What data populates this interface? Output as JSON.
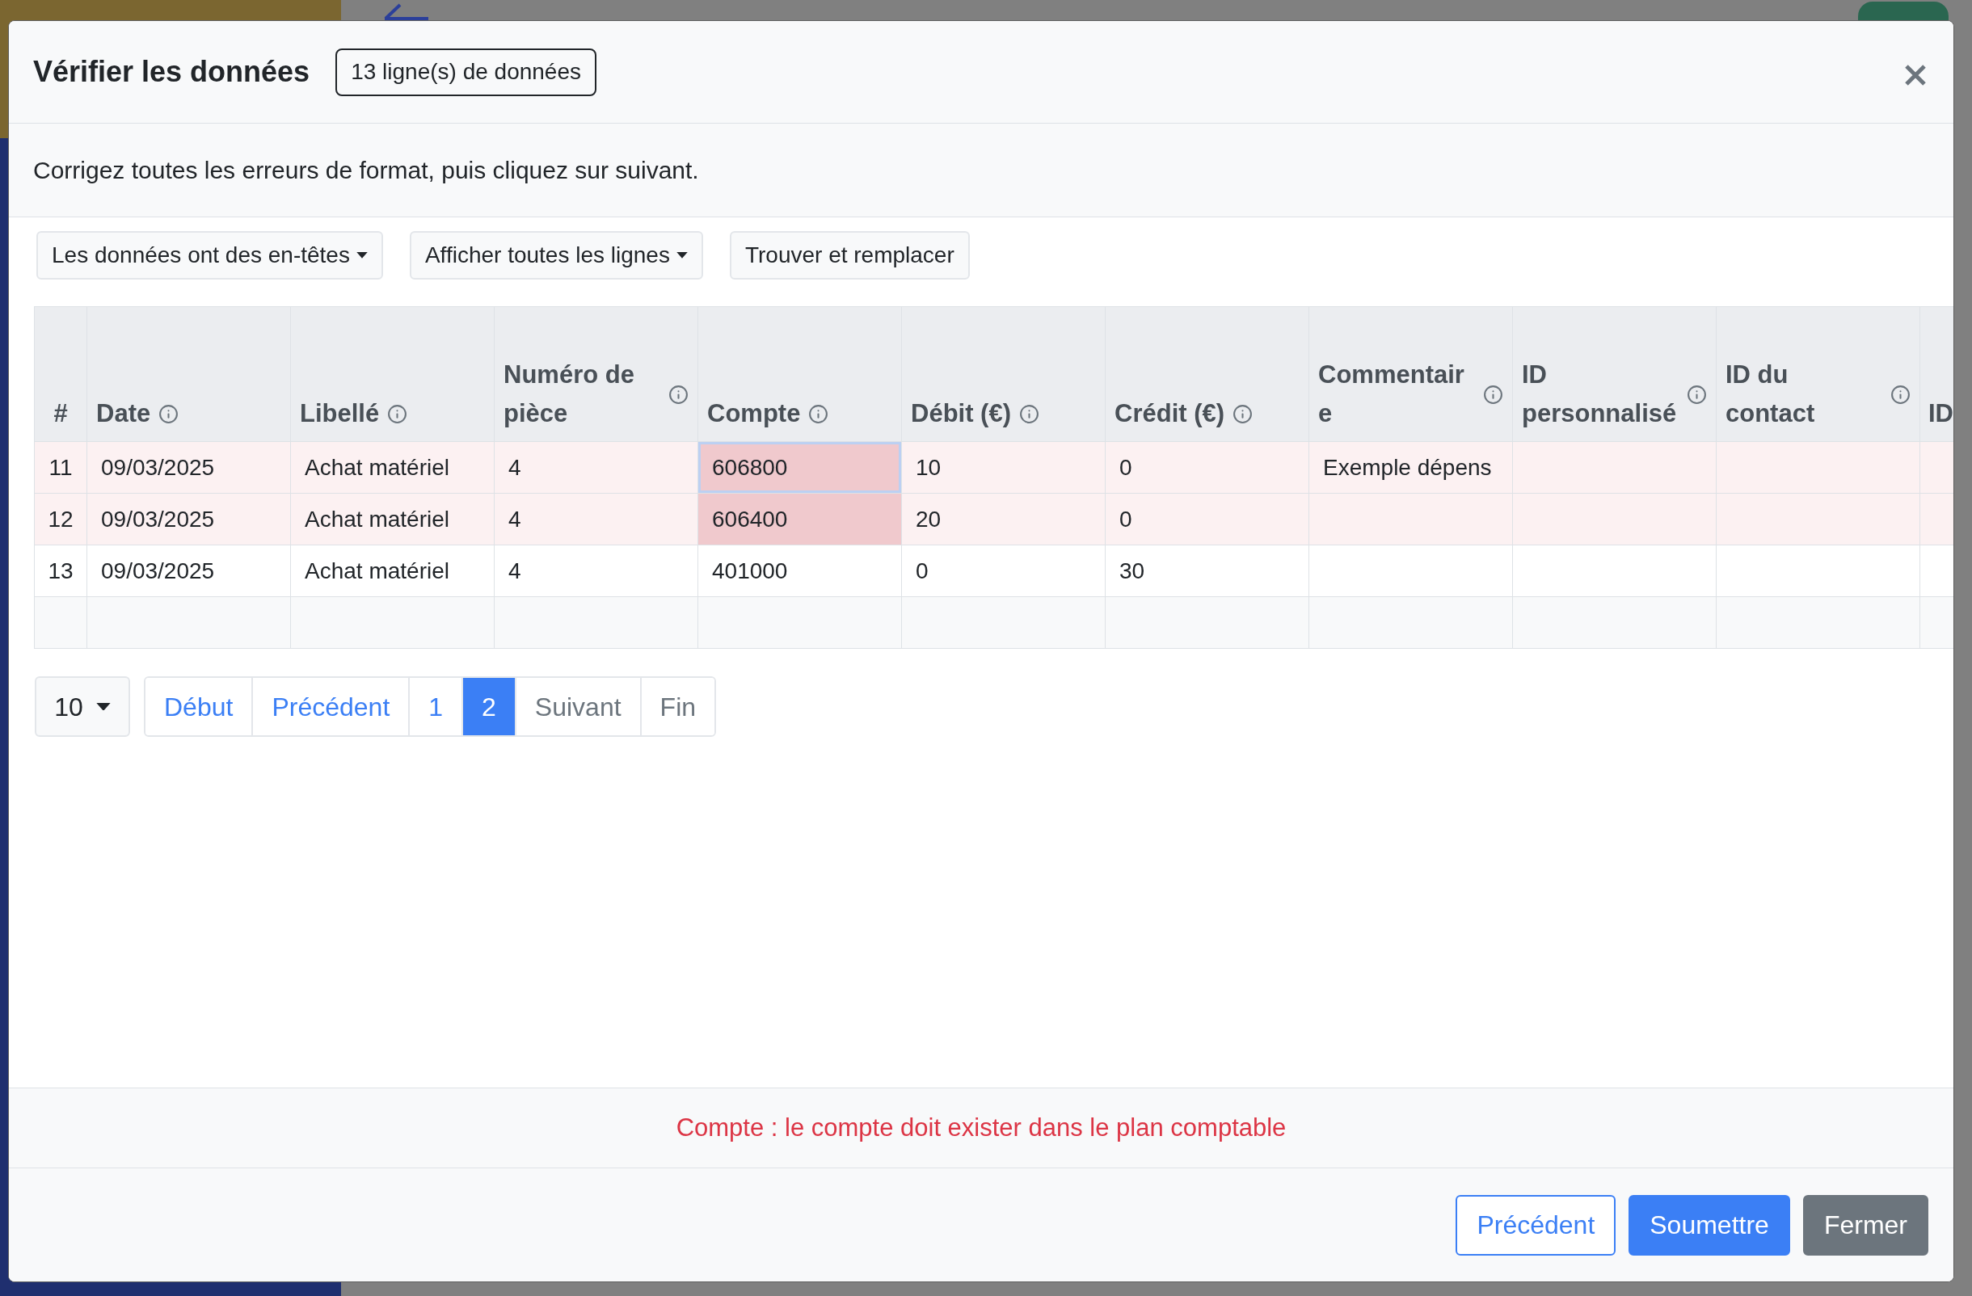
{
  "modal": {
    "title": "Vérifier les données",
    "row_count_badge": "13 ligne(s) de données",
    "instructions": "Corrigez toutes les erreurs de format, puis cliquez sur suivant.",
    "toolbar": [
      {
        "label": "Les données ont des en-têtes",
        "kind": "dropdown"
      },
      {
        "label": "Afficher toutes les lignes",
        "kind": "dropdown"
      },
      {
        "label": "Trouver et remplacer",
        "kind": "button"
      }
    ],
    "table": {
      "columns": [
        {
          "label": "#",
          "info": false
        },
        {
          "label": "Date",
          "info": true
        },
        {
          "label": "Libellé",
          "info": true
        },
        {
          "label": "Numéro de pièce",
          "info": true
        },
        {
          "label": "Compte",
          "info": true
        },
        {
          "label": "Débit (€)",
          "info": true
        },
        {
          "label": "Crédit (€)",
          "info": true
        },
        {
          "label": "Commentaire",
          "info": true
        },
        {
          "label": "ID personnalisé",
          "info": true
        },
        {
          "label": "ID du contact",
          "info": true
        },
        {
          "label": "ID",
          "info": false
        }
      ],
      "rows": [
        {
          "kind": "data",
          "invalid": true,
          "cells": [
            {
              "value": "11",
              "invalid": false,
              "selected": false
            },
            {
              "value": "09/03/2025",
              "invalid": false,
              "selected": false
            },
            {
              "value": "Achat matériel",
              "invalid": false,
              "selected": false
            },
            {
              "value": "4",
              "invalid": false,
              "selected": false
            },
            {
              "value": "606800",
              "invalid": true,
              "selected": true
            },
            {
              "value": "10",
              "invalid": false,
              "selected": false
            },
            {
              "value": "0",
              "invalid": false,
              "selected": false
            },
            {
              "value": "Exemple dépens",
              "invalid": false,
              "selected": false
            },
            {
              "invalid": false,
              "selected": false
            },
            {
              "invalid": false,
              "selected": false
            },
            {
              "invalid": false,
              "selected": false
            }
          ]
        },
        {
          "kind": "data",
          "invalid": true,
          "cells": [
            {
              "value": "12",
              "invalid": false,
              "selected": false
            },
            {
              "value": "09/03/2025",
              "invalid": false,
              "selected": false
            },
            {
              "value": "Achat matériel",
              "invalid": false,
              "selected": false
            },
            {
              "value": "4",
              "invalid": false,
              "selected": false
            },
            {
              "value": "606400",
              "invalid": true,
              "selected": false
            },
            {
              "value": "20",
              "invalid": false,
              "selected": false
            },
            {
              "value": "0",
              "invalid": false,
              "selected": false
            },
            {
              "invalid": false,
              "selected": false
            },
            {
              "invalid": false,
              "selected": false
            },
            {
              "invalid": false,
              "selected": false
            },
            {
              "invalid": false,
              "selected": false
            }
          ]
        },
        {
          "kind": "data",
          "invalid": false,
          "cells": [
            {
              "value": "13",
              "invalid": false,
              "selected": false
            },
            {
              "value": "09/03/2025",
              "invalid": false,
              "selected": false
            },
            {
              "value": "Achat matériel",
              "invalid": false,
              "selected": false
            },
            {
              "value": "4",
              "invalid": false,
              "selected": false
            },
            {
              "value": "401000",
              "invalid": false,
              "selected": false
            },
            {
              "value": "0",
              "invalid": false,
              "selected": false
            },
            {
              "value": "30",
              "invalid": false,
              "selected": false
            },
            {
              "invalid": false,
              "selected": false
            },
            {
              "invalid": false,
              "selected": false
            },
            {
              "invalid": false,
              "selected": false
            },
            {
              "invalid": false,
              "selected": false
            }
          ]
        },
        {
          "kind": "blank",
          "cells": [
            {
              "invalid": false,
              "selected": false
            },
            {
              "invalid": false,
              "selected": false
            },
            {
              "invalid": false,
              "selected": false
            },
            {
              "invalid": false,
              "selected": false
            },
            {
              "invalid": false,
              "selected": false
            },
            {
              "invalid": false,
              "selected": false
            },
            {
              "invalid": false,
              "selected": false
            },
            {
              "invalid": false,
              "selected": false
            },
            {
              "invalid": false,
              "selected": false
            },
            {
              "invalid": false,
              "selected": false
            },
            {
              "invalid": false,
              "selected": false
            }
          ]
        }
      ]
    },
    "pagination": {
      "page_size": "10",
      "items": [
        {
          "label": "Début",
          "selected": false,
          "disabled": false
        },
        {
          "label": "Précédent",
          "selected": false,
          "disabled": false
        },
        {
          "label": "1",
          "selected": false,
          "disabled": false
        },
        {
          "label": "2",
          "selected": true,
          "disabled": false
        },
        {
          "label": "Suivant",
          "selected": false,
          "disabled": true
        },
        {
          "label": "Fin",
          "selected": false,
          "disabled": true
        }
      ]
    },
    "error_message": "Compte : le compte doit exister dans le plan comptable",
    "footer_buttons": [
      {
        "label": "Précédent",
        "kind": "outline"
      },
      {
        "label": "Soumettre",
        "kind": "primary"
      },
      {
        "label": "Fermer",
        "kind": "secondary"
      }
    ]
  }
}
